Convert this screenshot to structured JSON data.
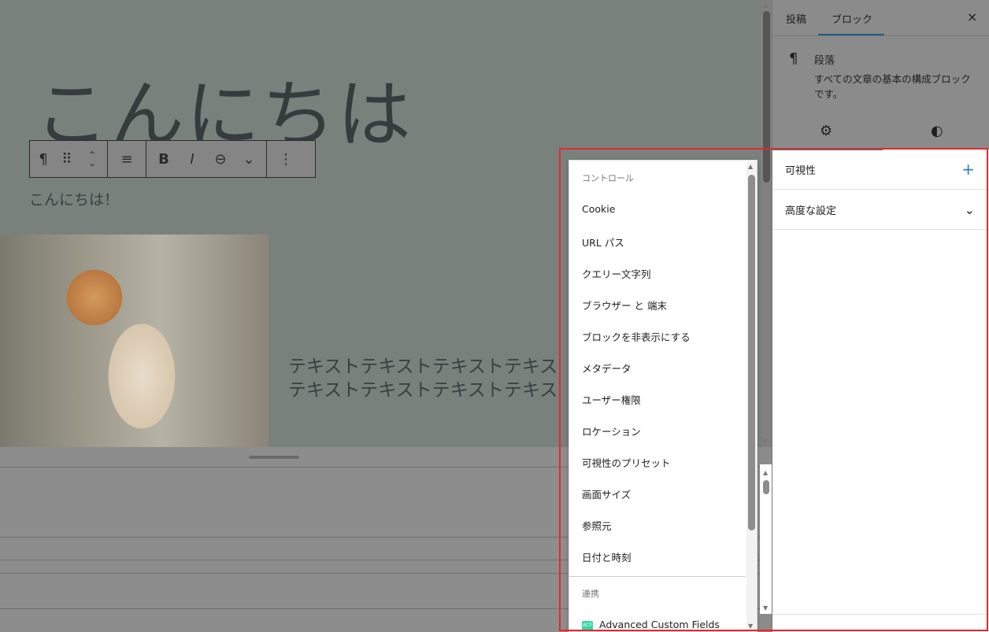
{
  "editor": {
    "title": "こんにちは",
    "paragraph": "こんにちは！",
    "text_line1": "テキストテキストテキストテキス",
    "text_line2": "テキストテキストテキストテキス"
  },
  "toolbar": {
    "paragraph": "¶",
    "drag": "⠿",
    "move": "⌃",
    "align": "≡",
    "bold": "B",
    "italic": "I",
    "link": "⊖",
    "more_rich": "⌄",
    "options": "⋮"
  },
  "sidebar": {
    "tabs": [
      "投稿",
      "ブロック"
    ],
    "close": "×",
    "block_name": "段落",
    "block_desc": "すべての文章の基本の構成ブロックです。",
    "block_icon": "¶",
    "panels": [
      {
        "label": "可視性",
        "icon": "+"
      },
      {
        "label": "高度な設定",
        "icon": "⌄"
      }
    ]
  },
  "dropdown": {
    "group1": "コントロール",
    "items": [
      "Cookie",
      "URL パス",
      "クエリー文字列",
      "ブラウザー と 端末",
      "ブロックを非表示にする",
      "メタデータ",
      "ユーザー権限",
      "ロケーション",
      "可視性のプリセット",
      "画面サイズ",
      "参照元",
      "日付と時刻"
    ],
    "group2": "連携",
    "integration": "Advanced Custom Fields",
    "acf_badge": "ACF"
  },
  "colors": {
    "accent": "#2b83b4",
    "highlight": "#e5282d",
    "acf": "#33d8a2"
  }
}
